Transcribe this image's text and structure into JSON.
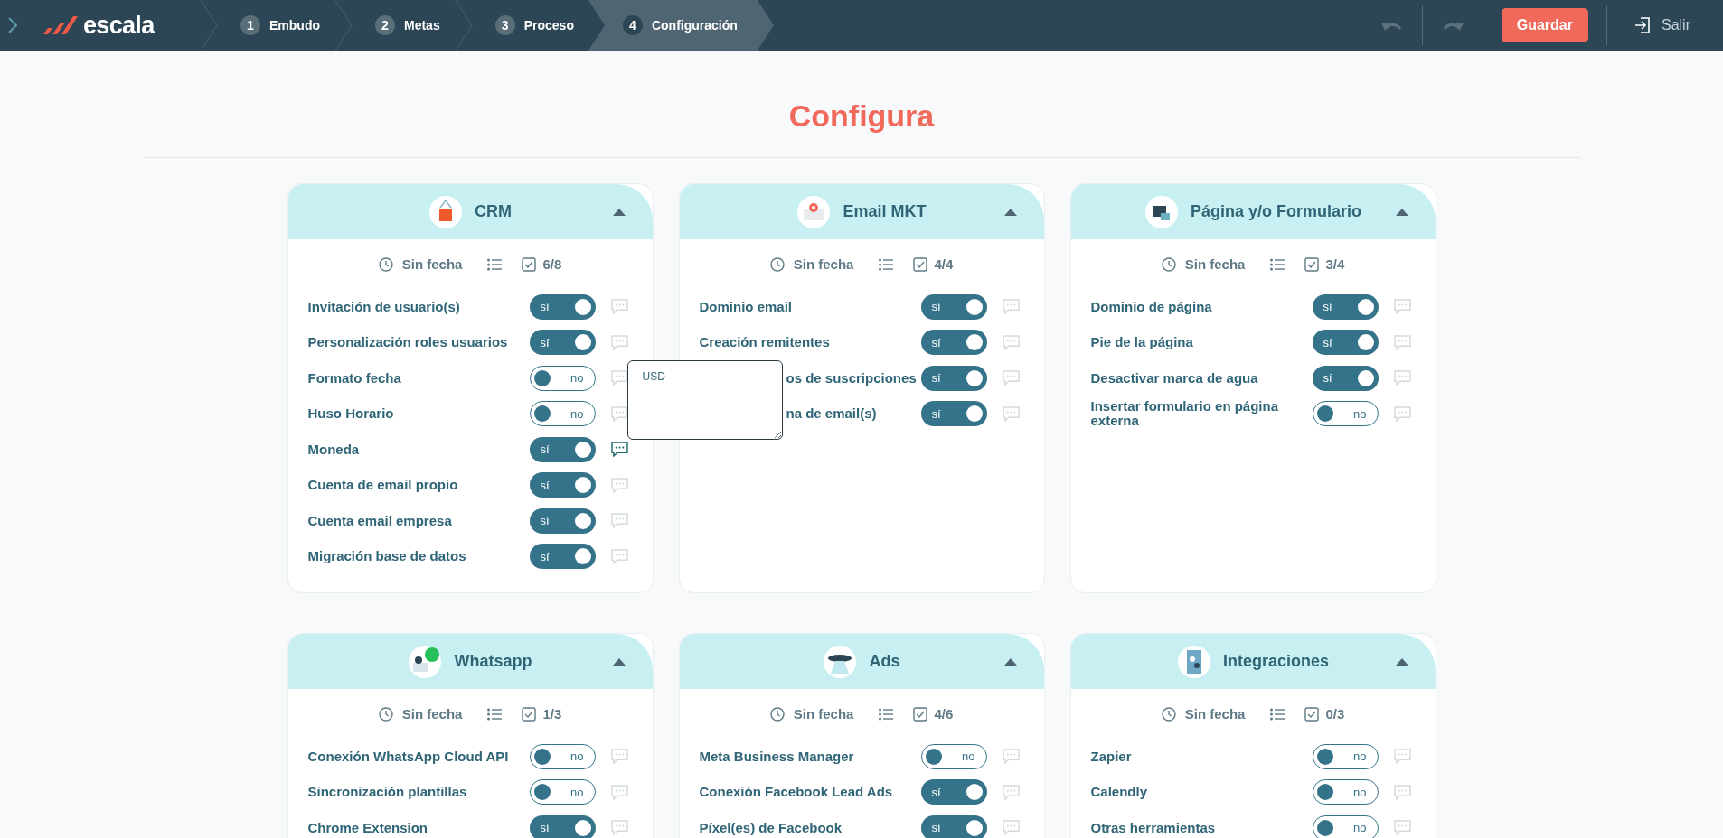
{
  "brand": "escala",
  "steps": [
    {
      "number": "1",
      "label": "Embudo",
      "selected": false
    },
    {
      "number": "2",
      "label": "Metas",
      "selected": false
    },
    {
      "number": "3",
      "label": "Proceso",
      "selected": false
    },
    {
      "number": "4",
      "label": "Configuración",
      "selected": true
    }
  ],
  "actions": {
    "save": "Guardar",
    "exit": "Salir"
  },
  "heading": "Configura",
  "comment_popup": {
    "value": "USD"
  },
  "cards": [
    {
      "kind": "crm",
      "title": "CRM",
      "date": "Sin fecha",
      "progress": "6/8",
      "items": [
        {
          "label": "Invitación de usuario(s)",
          "on": true,
          "toggle_text": "sí",
          "has_comment": false
        },
        {
          "label": "Personalización roles usuarios",
          "on": true,
          "toggle_text": "sí",
          "has_comment": false
        },
        {
          "label": "Formato fecha",
          "on": false,
          "toggle_text": "no",
          "has_comment": false
        },
        {
          "label": "Huso Horario",
          "on": false,
          "toggle_text": "no",
          "has_comment": false
        },
        {
          "label": "Moneda",
          "on": true,
          "toggle_text": "sí",
          "has_comment": true
        },
        {
          "label": "Cuenta de email propio",
          "on": true,
          "toggle_text": "sí",
          "has_comment": false
        },
        {
          "label": "Cuenta email empresa",
          "on": true,
          "toggle_text": "sí",
          "has_comment": false
        },
        {
          "label": "Migración base de datos",
          "on": true,
          "toggle_text": "sí",
          "has_comment": false
        }
      ]
    },
    {
      "kind": "email",
      "title": "Email MKT",
      "date": "Sin fecha",
      "progress": "4/4",
      "items": [
        {
          "label": "Dominio email",
          "on": true,
          "toggle_text": "sí",
          "has_comment": false
        },
        {
          "label": "Creación remitentes",
          "on": true,
          "toggle_text": "sí",
          "has_comment": false
        },
        {
          "label": "os de suscripciones",
          "on": true,
          "toggle_text": "sí",
          "has_comment": false,
          "partial": true
        },
        {
          "label": "na de email(s)",
          "on": true,
          "toggle_text": "sí",
          "has_comment": false,
          "partial": true
        }
      ]
    },
    {
      "kind": "page",
      "title": "Página y/o Formulario",
      "date": "Sin fecha",
      "progress": "3/4",
      "items": [
        {
          "label": "Dominio de página",
          "on": true,
          "toggle_text": "sí",
          "has_comment": false
        },
        {
          "label": "Pie de la página",
          "on": true,
          "toggle_text": "sí",
          "has_comment": false
        },
        {
          "label": "Desactivar marca de agua",
          "on": true,
          "toggle_text": "sí",
          "has_comment": false
        },
        {
          "label": "Insertar formulario en página externa",
          "on": false,
          "toggle_text": "no",
          "has_comment": false
        }
      ]
    },
    {
      "kind": "whatsapp",
      "title": "Whatsapp",
      "date": "Sin fecha",
      "progress": "1/3",
      "items": [
        {
          "label": "Conexión WhatsApp Cloud API",
          "on": false,
          "toggle_text": "no",
          "has_comment": false
        },
        {
          "label": "Sincronización plantillas",
          "on": false,
          "toggle_text": "no",
          "has_comment": false
        },
        {
          "label": "Chrome Extension",
          "on": true,
          "toggle_text": "sí",
          "has_comment": false
        }
      ]
    },
    {
      "kind": "ads",
      "title": "Ads",
      "date": "Sin fecha",
      "progress": "4/6",
      "items": [
        {
          "label": "Meta Business Manager",
          "on": false,
          "toggle_text": "no",
          "has_comment": false
        },
        {
          "label": "Conexión Facebook Lead Ads",
          "on": true,
          "toggle_text": "sí",
          "has_comment": false
        },
        {
          "label": "Píxel(es) de Facebook",
          "on": true,
          "toggle_text": "sí",
          "has_comment": false
        }
      ]
    },
    {
      "kind": "integrations",
      "title": "Integraciones",
      "date": "Sin fecha",
      "progress": "0/3",
      "items": [
        {
          "label": "Zapier",
          "on": false,
          "toggle_text": "no",
          "has_comment": false
        },
        {
          "label": "Calendly",
          "on": false,
          "toggle_text": "no",
          "has_comment": false
        },
        {
          "label": "Otras herramientas",
          "on": false,
          "toggle_text": "no",
          "has_comment": false
        }
      ]
    }
  ]
}
